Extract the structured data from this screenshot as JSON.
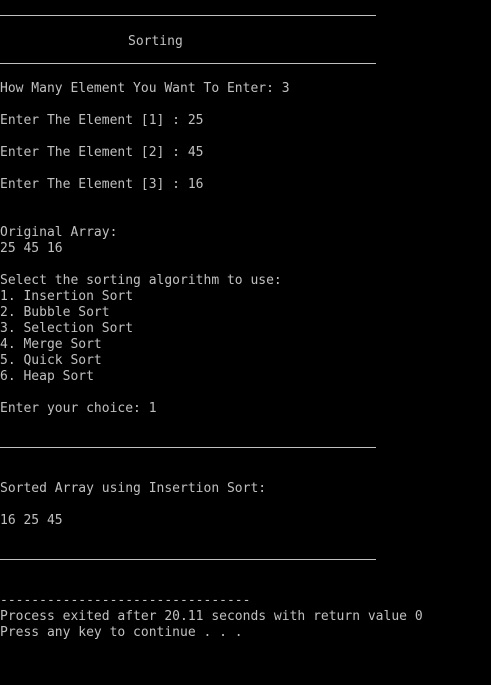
{
  "console": {
    "header_title": "Sorting",
    "prompt_count": "How Many Element You Want To Enter: 3",
    "element_prompts": [
      "Enter The Element [1] : 25",
      "Enter The Element [2] : 45",
      "Enter The Element [3] : 16"
    ],
    "original_label": "Original Array:",
    "original_values": "25 45 16",
    "menu_title": "Select the sorting algorithm to use:",
    "menu_items": [
      "1. Insertion Sort",
      "2. Bubble Sort",
      "3. Selection Sort",
      "4. Merge Sort",
      "5. Quick Sort",
      "6. Heap Sort"
    ],
    "choice_prompt": "Enter your choice: 1",
    "sorted_label": "Sorted Array using Insertion Sort:",
    "sorted_values": "16 25 45",
    "dash_line": "--------------------------------",
    "exit_message": "Process exited after 20.11 seconds with return value 0",
    "continue_message": "Press any key to continue . . ."
  },
  "colors": {
    "background": "#000000",
    "text": "#c0c0c0"
  }
}
